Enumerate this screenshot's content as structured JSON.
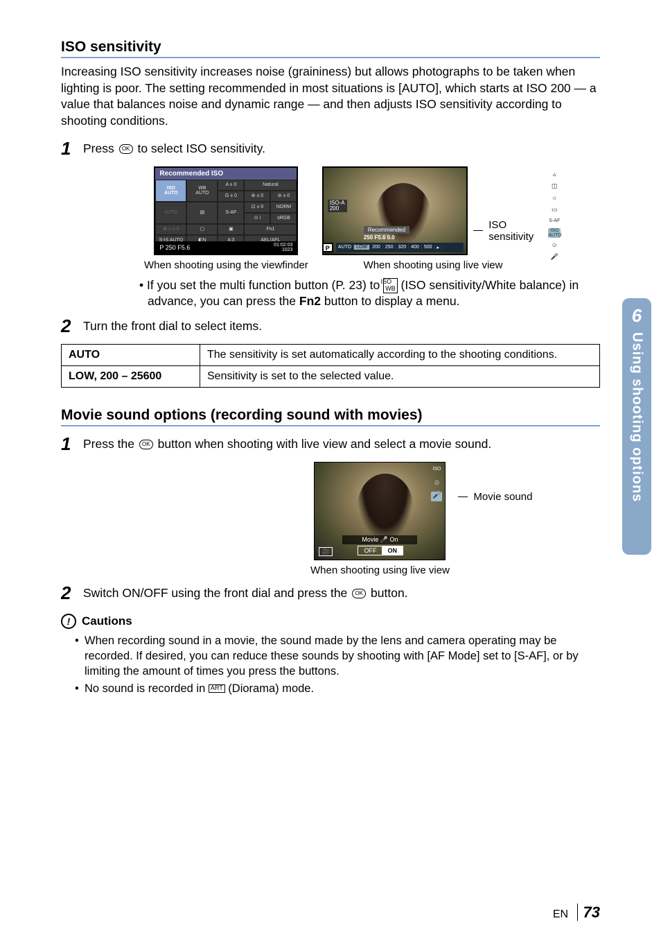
{
  "section1": {
    "title": "ISO sensitivity",
    "intro": "Increasing ISO sensitivity increases noise (graininess) but allows photographs to be taken when lighting is poor. The setting recommended in most situations is [AUTO], which starts at ISO 200 — a value that balances noise and dynamic range — and then adjusts ISO sensitivity according to shooting conditions.",
    "step1_pre": "Press ",
    "step1_post": " to select ISO sensitivity.",
    "vf": {
      "header": "Recommended ISO",
      "r0c0a": "ISO",
      "r0c0b": "AUTO",
      "r0c1a": "WB",
      "r0c1b": "AUTO",
      "r0c2a": "A ± 0",
      "r0c2b": "G ± 0",
      "r0c3": "Natural",
      "r1c3a": "⊛ ± 0",
      "r1c3b": "⊚ ± 0",
      "r2c0": "AUTO",
      "r2c2": "S-AF",
      "r2c3a": "⊡ ± 0",
      "r2c3b": "NORM",
      "r3c3a": "⊙ i",
      "r3c3b": "sRGB",
      "r4c0": "✿ ± 0.0",
      "r4c1": "▢",
      "r4c2": "▣",
      "r4c3": "Fn1",
      "r5c0": "S-IS AUTO",
      "r5c1": "◧N",
      "r5c2": "4:3",
      "r5c3": "AEL/AFL",
      "bot_left": "P   250  F5.6",
      "bot_right": "01:02:03\n1023"
    },
    "lv": {
      "iso_label": "ISO-A\n200",
      "rec_label": "Recommended",
      "rec_vals": "250   F5.6   0.0",
      "bar": [
        "AUTO",
        "LOW",
        "200",
        "250",
        "320",
        "400",
        "500",
        "▸"
      ]
    },
    "caption_vf": "When shooting using the viewfinder",
    "caption_lv": "When shooting using live view",
    "pointer_label": "ISO sensitivity",
    "bullet_pre": "If you set the multi function button (P. 23) to ",
    "bullet_mid": " (ISO sensitivity/White balance) in advance, you can press the ",
    "bullet_btn": "Fn2",
    "bullet_post": " button to display a menu.",
    "step2": "Turn the front dial to select items.",
    "table": {
      "r0c0": "AUTO",
      "r0c1": "The sensitivity is set automatically according to the shooting conditions.",
      "r1c0": "LOW, 200 – 25600",
      "r1c1": "Sensitivity is set to the selected value."
    }
  },
  "section2": {
    "title": "Movie sound options (recording sound with movies)",
    "step1_pre": "Press the ",
    "step1_post": " button when shooting with live view and select a movie sound.",
    "mv": {
      "bar": "Movie 🎤 On",
      "off": "OFF",
      "on": "ON"
    },
    "pointer_label": "Movie sound",
    "caption": "When shooting using live view",
    "step2_pre": "Switch ON/OFF using the front dial and press the ",
    "step2_post": " button."
  },
  "cautions": {
    "heading": "Cautions",
    "c1": "When recording sound in a movie, the sound made by the lens and camera operating may be recorded. If desired, you can reduce these sounds by shooting with [AF Mode] set to [S-AF], or by limiting the amount of times you press the buttons.",
    "c2_pre": "No sound is recorded in ",
    "c2_post": " (Diorama) mode."
  },
  "sidebar": {
    "num": "6",
    "text": "Using shooting options"
  },
  "footer": {
    "lang": "EN",
    "page": "73"
  },
  "glyphs": {
    "ok": "OK",
    "iso_wb": "ISO\nWB",
    "art": "ART"
  }
}
